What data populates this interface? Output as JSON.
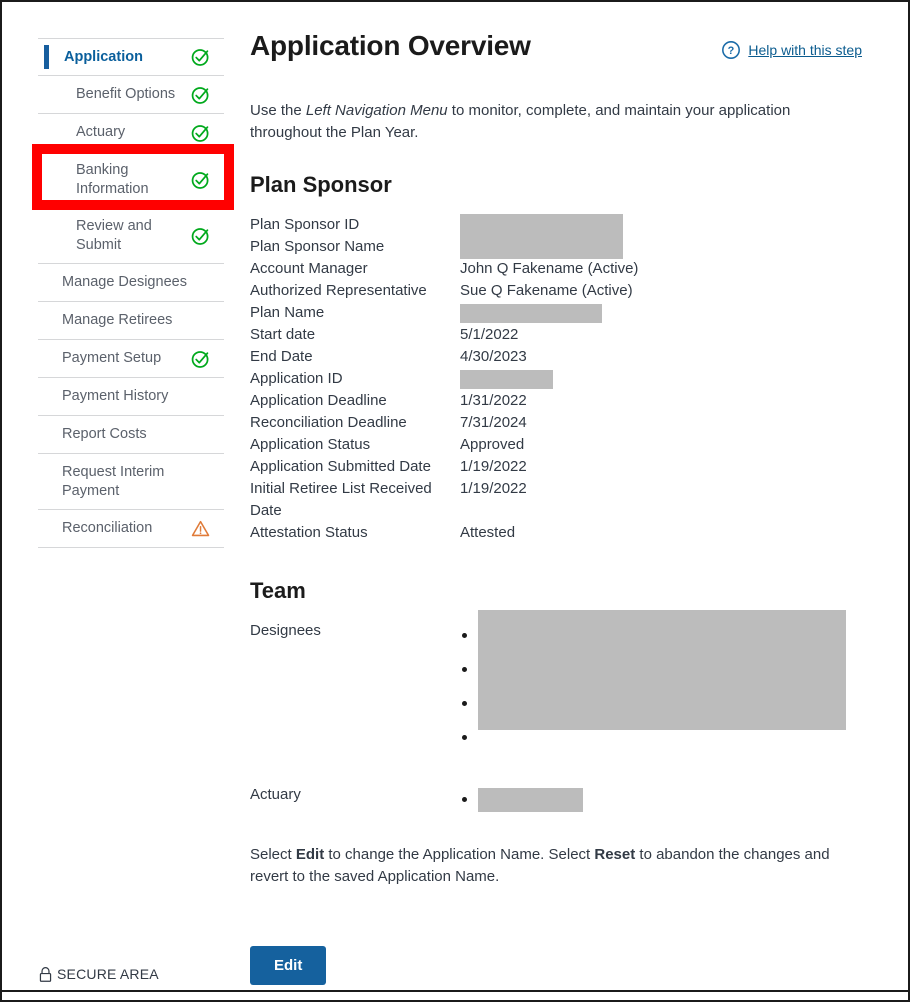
{
  "sidebar": {
    "items": [
      {
        "label": "Application",
        "icon": "check-circle-icon",
        "state": "complete",
        "active": true,
        "sub": false
      },
      {
        "label": "Benefit Options",
        "icon": "check-circle-icon",
        "state": "complete",
        "active": false,
        "sub": true
      },
      {
        "label": "Actuary",
        "icon": "check-circle-icon",
        "state": "complete",
        "active": false,
        "sub": true
      },
      {
        "label": "Banking Information",
        "icon": "check-circle-icon",
        "state": "complete",
        "active": false,
        "sub": true,
        "highlighted": true
      },
      {
        "label": "Review and Submit",
        "icon": "check-circle-icon",
        "state": "complete",
        "active": false,
        "sub": true
      },
      {
        "label": "Manage Designees",
        "icon": "none",
        "state": "none",
        "active": false,
        "sub": false
      },
      {
        "label": "Manage Retirees",
        "icon": "none",
        "state": "none",
        "active": false,
        "sub": false
      },
      {
        "label": "Payment Setup",
        "icon": "check-circle-icon",
        "state": "complete",
        "active": false,
        "sub": false
      },
      {
        "label": "Payment History",
        "icon": "none",
        "state": "none",
        "active": false,
        "sub": false
      },
      {
        "label": "Report Costs",
        "icon": "none",
        "state": "none",
        "active": false,
        "sub": false
      },
      {
        "label": "Request Interim Payment",
        "icon": "none",
        "state": "none",
        "active": false,
        "sub": false
      },
      {
        "label": "Reconciliation",
        "icon": "warning-triangle-icon",
        "state": "warning",
        "active": false,
        "sub": false
      }
    ]
  },
  "header": {
    "title": "Application Overview",
    "help_label": "Help with this step",
    "help_icon": "question-circle-icon"
  },
  "intro": {
    "before": "Use the ",
    "emphasis": "Left Navigation Menu",
    "after": " to monitor, complete, and maintain your application throughout the Plan Year."
  },
  "plan_sponsor": {
    "heading": "Plan Sponsor",
    "rows": [
      {
        "key": "Plan Sponsor ID",
        "value": "",
        "redacted": true
      },
      {
        "key": "Plan Sponsor Name",
        "value": "",
        "redacted": true
      },
      {
        "key": "Account Manager",
        "value": "John Q Fakename (Active)",
        "redacted": false
      },
      {
        "key": "Authorized Representative",
        "value": "Sue Q Fakename (Active)",
        "redacted": false
      },
      {
        "key": "Plan Name",
        "value": "",
        "redacted": true
      },
      {
        "key": "Start date",
        "value": "5/1/2022",
        "redacted": false
      },
      {
        "key": "End Date",
        "value": "4/30/2023",
        "redacted": false
      },
      {
        "key": "Application ID",
        "value": "",
        "redacted": true
      },
      {
        "key": "Application Deadline",
        "value": "1/31/2022",
        "redacted": false
      },
      {
        "key": "Reconciliation Deadline",
        "value": "7/31/2024",
        "redacted": false
      },
      {
        "key": "Application Status",
        "value": "Approved",
        "redacted": false
      },
      {
        "key": "Application Submitted Date",
        "value": "1/19/2022",
        "redacted": false
      },
      {
        "key": "Initial Retiree List Received Date",
        "value": "1/19/2022",
        "redacted": false
      },
      {
        "key": "Attestation Status",
        "value": "Attested",
        "redacted": false
      }
    ]
  },
  "team": {
    "heading": "Team",
    "designees_label": "Designees",
    "designees": [
      {
        "value": "",
        "redacted": true
      },
      {
        "value": "",
        "redacted": true
      },
      {
        "value": "",
        "redacted": true
      },
      {
        "value": "",
        "redacted": true
      }
    ],
    "actuary_label": "Actuary",
    "actuary": [
      {
        "value": "",
        "redacted": true
      }
    ]
  },
  "note": {
    "p1": "Select ",
    "b1": "Edit",
    "p2": " to change the Application Name. Select ",
    "b2": "Reset",
    "p3": " to abandon the changes and revert to the saved Application Name."
  },
  "actions": {
    "edit_label": "Edit"
  },
  "footer": {
    "secure_label": "SECURE AREA",
    "lock_icon": "lock-icon"
  },
  "colors": {
    "accent_blue": "#15619e",
    "link_blue": "#0b5c8f",
    "success_green": "#00a91c",
    "warning_orange": "#e07b39",
    "highlight_red": "#ff0000",
    "redaction_gray": "#bcbcbc"
  }
}
